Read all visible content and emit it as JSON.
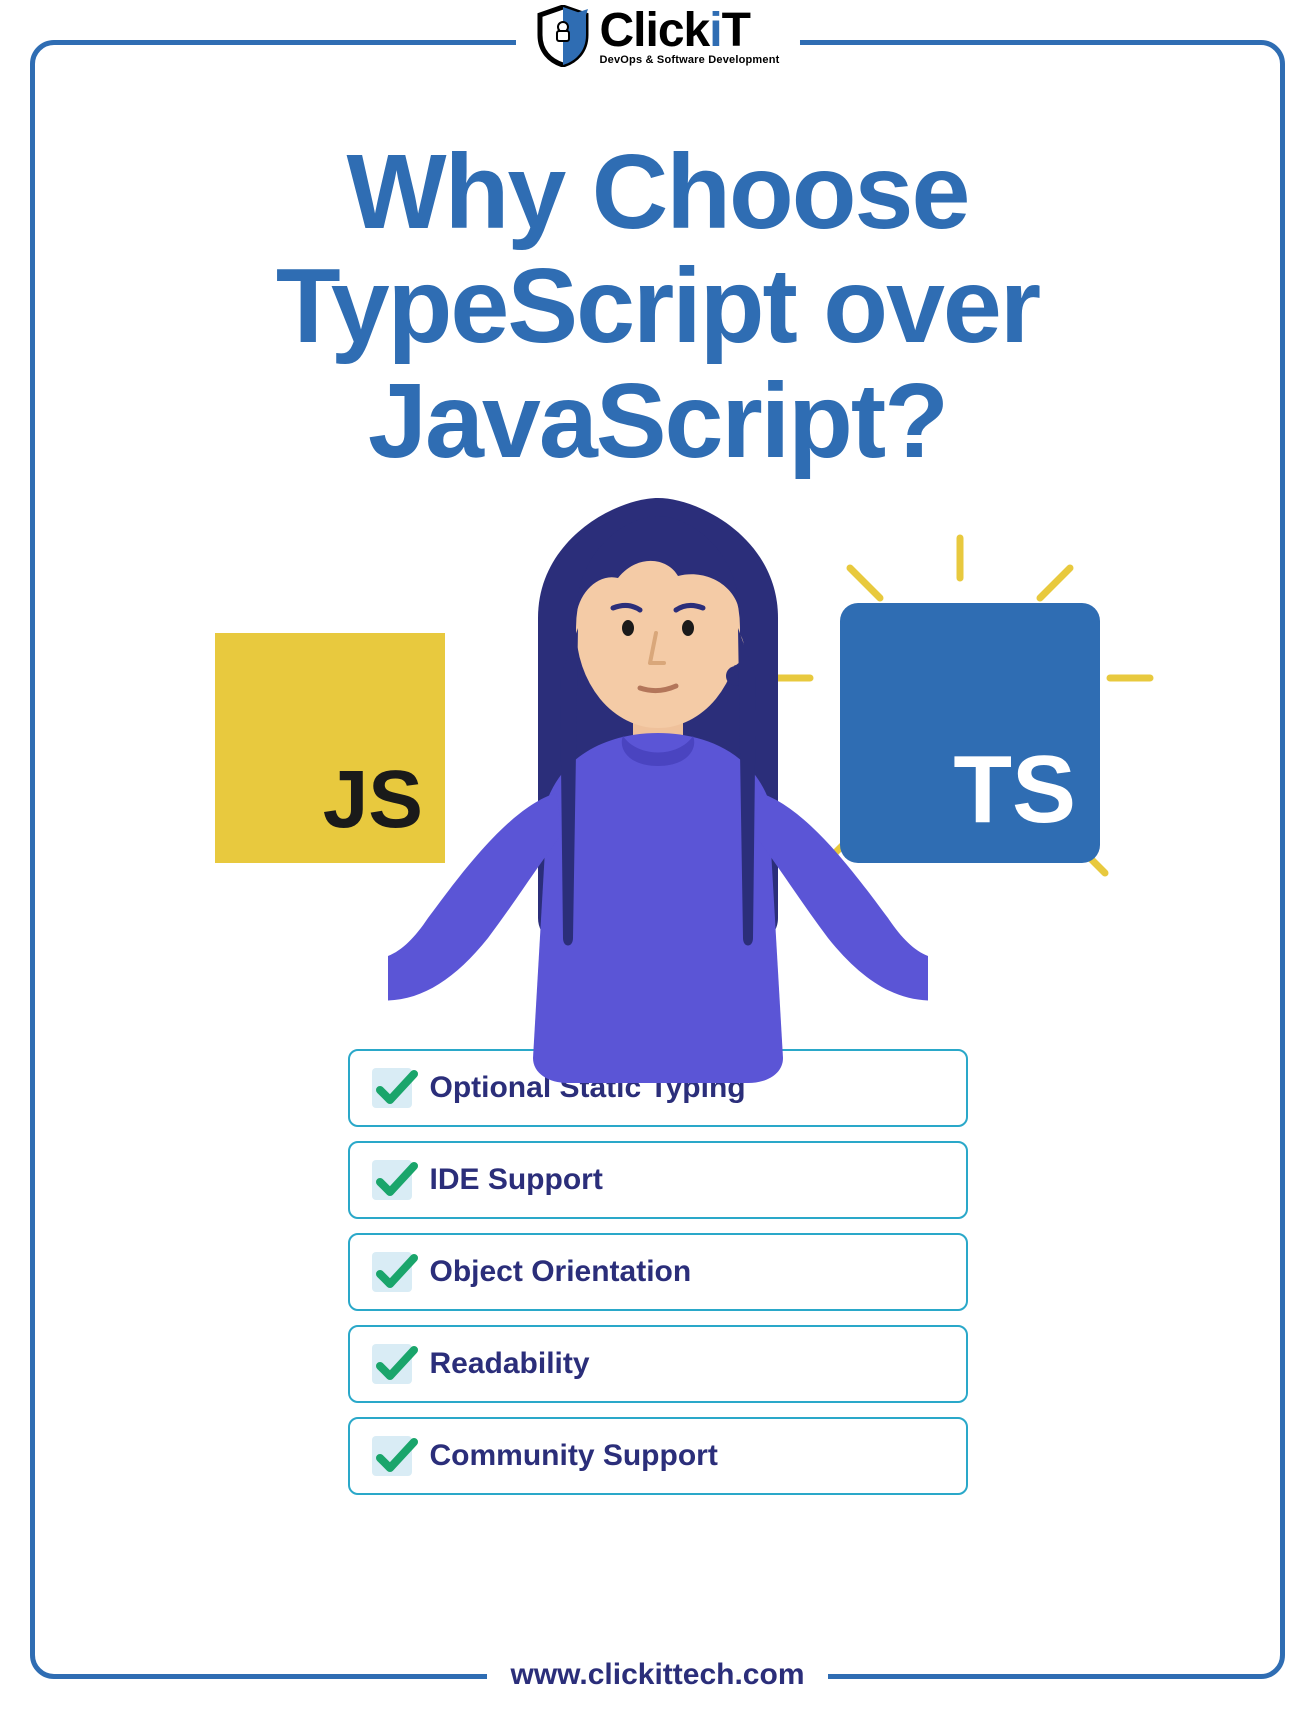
{
  "logo": {
    "word_pre": "Click",
    "word_i": "i",
    "word_post": "T",
    "sub": "DevOps & Software Development"
  },
  "title": "Why Choose TypeScript over JavaScript?",
  "js_label": "JS",
  "ts_label": "TS",
  "items": [
    {
      "label": "Optional Static Typing"
    },
    {
      "label": "IDE Support"
    },
    {
      "label": "Object Orientation"
    },
    {
      "label": "Readability"
    },
    {
      "label": "Community Support"
    }
  ],
  "url": "www.clickittech.com"
}
